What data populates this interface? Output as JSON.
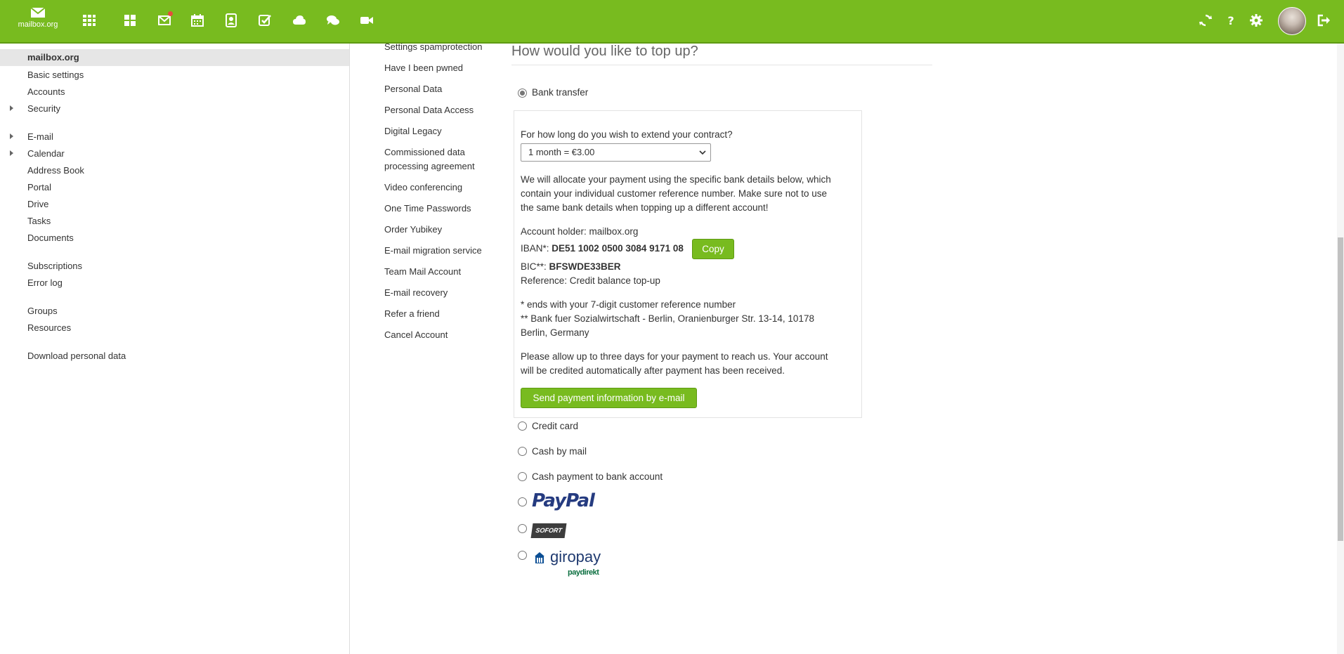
{
  "header": {
    "logo_text": "mailbox.org",
    "apps": [
      "apps-grid-icon",
      "portal-icon",
      "mail-icon",
      "calendar-icon",
      "address-book-icon",
      "tasks-icon",
      "drive-icon",
      "chat-icon",
      "video-icon"
    ],
    "right_icons": [
      "refresh-icon",
      "help-icon",
      "settings-icon",
      "avatar",
      "logout-icon"
    ]
  },
  "sidebar": {
    "selected": "mailbox.org",
    "items": [
      "Basic settings",
      "Accounts",
      "Security",
      "E-mail",
      "Calendar",
      "Address Book",
      "Portal",
      "Drive",
      "Tasks",
      "Documents",
      "Subscriptions",
      "Error log",
      "Groups",
      "Resources",
      "Download personal data"
    ]
  },
  "submenu": {
    "items": [
      "Settings spamprotection",
      "Have I been pwned",
      "Personal Data",
      "Personal Data Access",
      "Digital Legacy",
      "Commissioned data",
      "processing agreement",
      "Video conferencing",
      "One Time Passwords",
      "Order Yubikey",
      "E-mail migration service",
      "Team Mail Account",
      "E-mail recovery",
      "Refer a friend",
      "Cancel Account"
    ]
  },
  "main": {
    "heading": "How would you like to top up?",
    "bank_transfer": "Bank transfer",
    "extend_question": "For how long do you wish to extend your contract?",
    "duration_selected": "1 month = €3.00",
    "allocation_text": [
      "We will allocate your payment using the specific bank details below, which",
      "contain your individual customer reference number. Make sure not to use",
      "the same bank details when topping up a different account!"
    ],
    "account_holder": "Account holder: mailbox.org",
    "iban_label": "IBAN*: ",
    "iban_value": "DE51 1002 0500 3084 9171 08",
    "copy_label": "Copy",
    "bic_label": "BIC**: ",
    "bic_value": "BFSWDE33BER",
    "reference": "Reference: Credit balance top-up",
    "footnote1": "* ends with your 7-digit customer reference number",
    "footnote2": [
      "** Bank fuer Sozialwirtschaft - Berlin, Oranienburger Str. 13-14, 10178",
      "Berlin, Germany"
    ],
    "allow_text": [
      "Please allow up to three days for your payment to reach us. Your account",
      "will be credited automatically after payment has been received."
    ],
    "send_button": "Send payment information by e-mail",
    "options": [
      "Credit card",
      "Cash by mail",
      "Cash payment to bank account"
    ],
    "paypal": "PayPal",
    "sofort": "SOFORT",
    "giropay": "giropay",
    "paydirekt": "paydirekt"
  }
}
